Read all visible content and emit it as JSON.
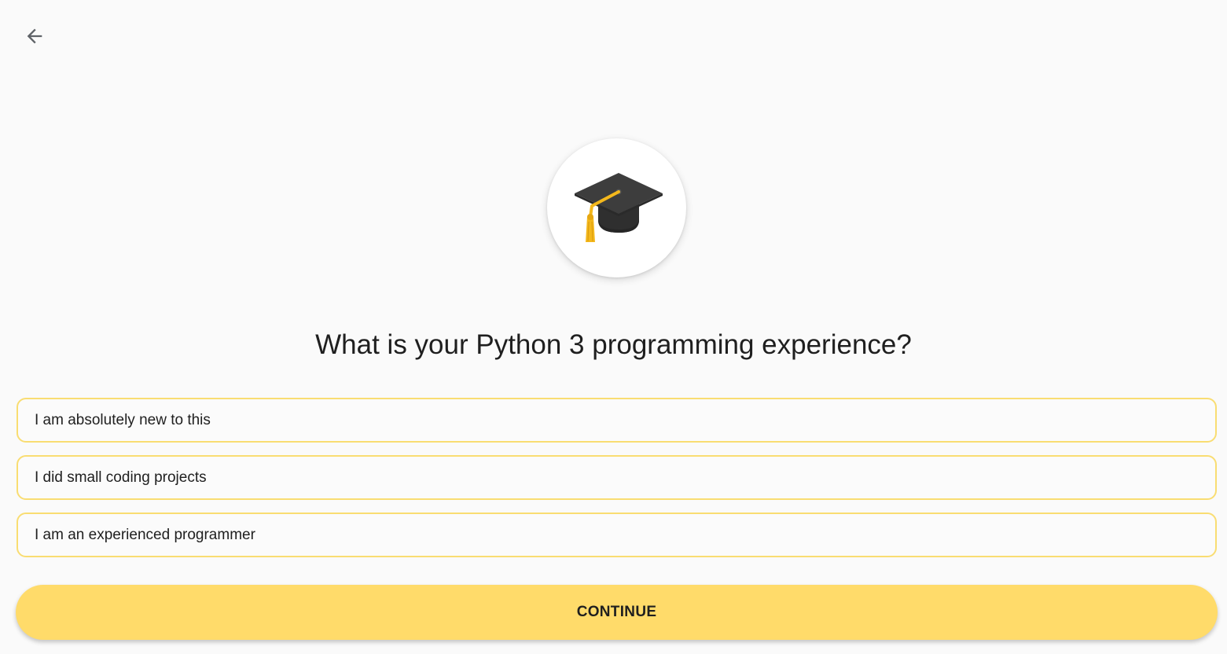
{
  "header": {
    "back_icon": "arrow-left-icon"
  },
  "hero": {
    "icon": "graduation-cap-icon"
  },
  "question": {
    "text": "What is your Python 3 programming experience?"
  },
  "options": [
    {
      "label": "I am absolutely new to this"
    },
    {
      "label": "I did small coding projects"
    },
    {
      "label": "I am an experienced programmer"
    }
  ],
  "actions": {
    "continue_label": "CONTINUE"
  },
  "colors": {
    "accent": "#ffdb6a",
    "option_border": "#f9dd72",
    "background": "#fafafa"
  }
}
